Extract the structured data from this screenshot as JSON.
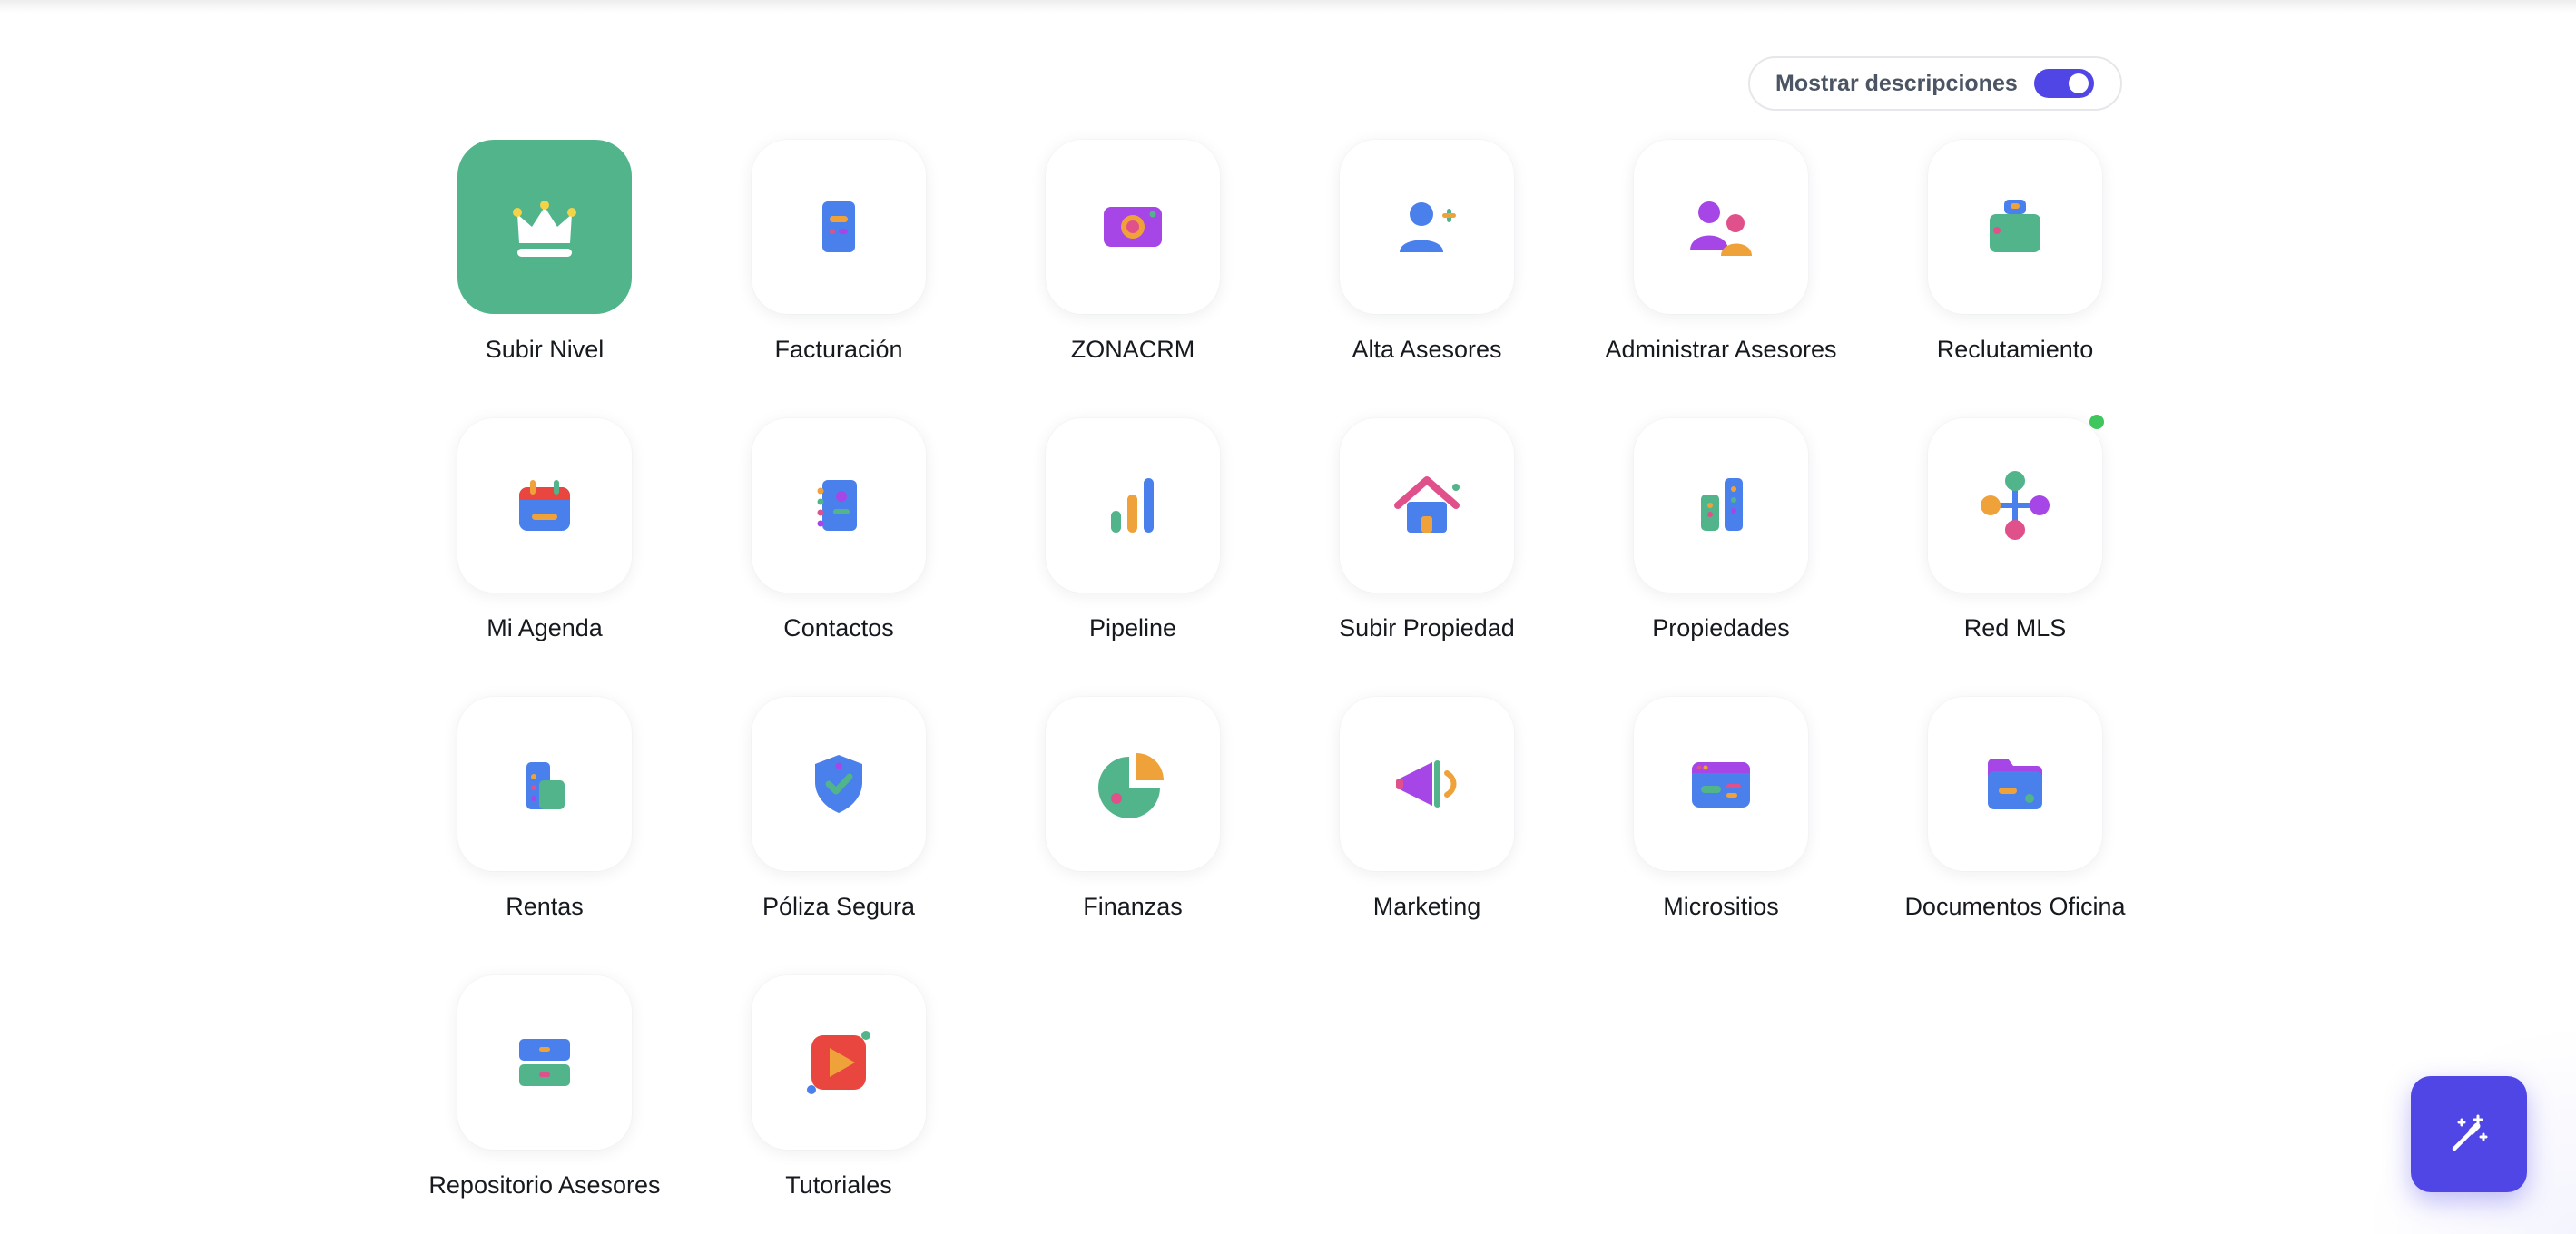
{
  "toggle": {
    "label": "Mostrar descripciones",
    "checked": true
  },
  "apps": [
    {
      "label": "Subir Nivel",
      "icon": "crown-icon",
      "accent": "#52b48a"
    },
    {
      "label": "Facturación",
      "icon": "invoice-icon"
    },
    {
      "label": "ZONACRM",
      "icon": "crm-icon"
    },
    {
      "label": "Alta Asesores",
      "icon": "add-user-icon"
    },
    {
      "label": "Administrar Asesores",
      "icon": "users-icon"
    },
    {
      "label": "Reclutamiento",
      "icon": "briefcase-icon"
    },
    {
      "label": "Mi Agenda",
      "icon": "calendar-icon"
    },
    {
      "label": "Contactos",
      "icon": "address-book-icon"
    },
    {
      "label": "Pipeline",
      "icon": "bar-chart-icon"
    },
    {
      "label": "Subir Propiedad",
      "icon": "house-upload-icon"
    },
    {
      "label": "Propiedades",
      "icon": "buildings-icon"
    },
    {
      "label": "Red MLS",
      "icon": "network-icon",
      "notification": true
    },
    {
      "label": "Rentas",
      "icon": "rent-icon"
    },
    {
      "label": "Póliza Segura",
      "icon": "shield-check-icon"
    },
    {
      "label": "Finanzas",
      "icon": "pie-chart-icon"
    },
    {
      "label": "Marketing",
      "icon": "megaphone-icon"
    },
    {
      "label": "Micrositios",
      "icon": "browser-icon"
    },
    {
      "label": "Documentos Oficina",
      "icon": "folder-icon"
    },
    {
      "label": "Repositorio Asesores",
      "icon": "repository-icon"
    },
    {
      "label": "Tutoriales",
      "icon": "play-icon"
    }
  ],
  "fab": {
    "icon": "magic-wand-icon"
  },
  "colors": {
    "accent": "#4f46e5",
    "green": "#52b48a",
    "blue": "#4a80ec",
    "purple": "#a646e6",
    "orange": "#f0a23a",
    "pink": "#e0508b",
    "status": "#3fc65d"
  }
}
